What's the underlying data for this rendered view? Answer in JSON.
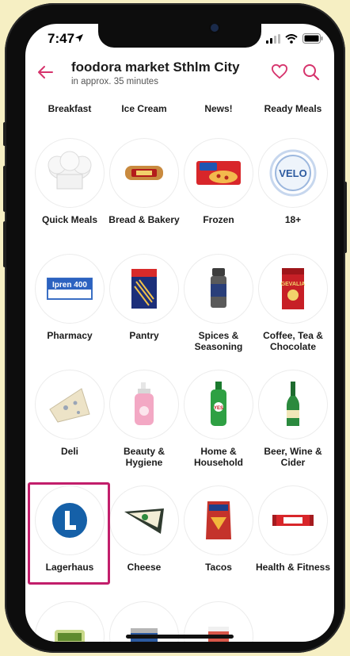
{
  "status": {
    "time": "7:47"
  },
  "header": {
    "title": "foodora market Sthlm City",
    "subtitle": "in approx. 35 minutes"
  },
  "top_labels": [
    "Breakfast",
    "Ice Cream",
    "News!",
    "Ready Meals"
  ],
  "categories": [
    {
      "label": "Quick Meals",
      "icon": "chef-hat-icon"
    },
    {
      "label": "Bread & Bakery",
      "icon": "bread-icon"
    },
    {
      "label": "Frozen",
      "icon": "frozen-pizza-icon"
    },
    {
      "label": "18+",
      "icon": "velo-snus-icon"
    },
    {
      "label": "Pharmacy",
      "icon": "medicine-box-icon"
    },
    {
      "label": "Pantry",
      "icon": "pasta-box-icon"
    },
    {
      "label": "Spices & Seasoning",
      "icon": "spice-jar-icon"
    },
    {
      "label": "Coffee, Tea & Chocolate",
      "icon": "coffee-pack-icon"
    },
    {
      "label": "Deli",
      "icon": "cheese-wedge-icon"
    },
    {
      "label": "Beauty & Hygiene",
      "icon": "soap-bottle-icon"
    },
    {
      "label": "Home & Household",
      "icon": "detergent-bottle-icon"
    },
    {
      "label": "Beer, Wine & Cider",
      "icon": "beer-bottle-icon"
    },
    {
      "label": "Lagerhaus",
      "icon": "lagerhaus-logo-icon"
    },
    {
      "label": "Cheese",
      "icon": "cheese-slice-icon"
    },
    {
      "label": "Tacos",
      "icon": "nacho-bag-icon"
    },
    {
      "label": "Health & Fitness",
      "icon": "protein-bar-icon"
    }
  ],
  "colors": {
    "accent": "#d6336c",
    "highlight": "#c21e6b",
    "lagerhaus_blue": "#1560a8"
  }
}
